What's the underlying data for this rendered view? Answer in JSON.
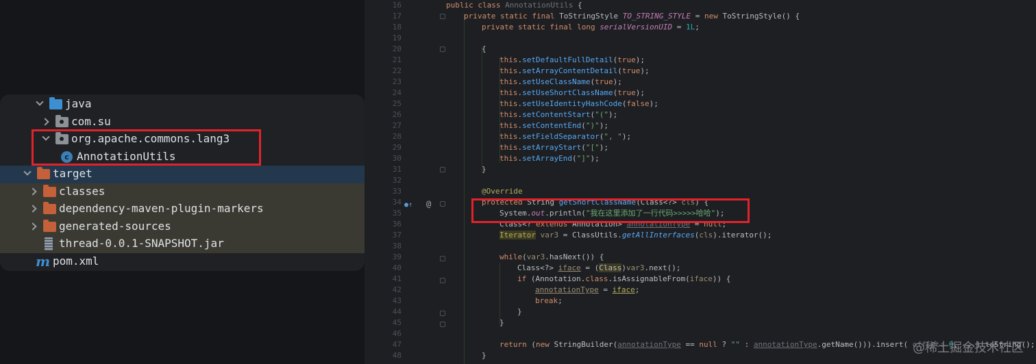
{
  "tree": {
    "items": [
      {
        "label": "java"
      },
      {
        "label": "com.su"
      },
      {
        "label": "org.apache.commons.lang3"
      },
      {
        "label": "AnnotationUtils"
      },
      {
        "label": "target"
      },
      {
        "label": "classes"
      },
      {
        "label": "dependency-maven-plugin-markers"
      },
      {
        "label": "generated-sources"
      },
      {
        "label": "thread-0.0.1-SNAPSHOT.jar"
      },
      {
        "label": "pom.xml"
      }
    ],
    "class_icon_letter": "c",
    "maven_icon_letter": "m"
  },
  "editor": {
    "line_numbers": [
      "16",
      "17",
      "18",
      "19",
      "20",
      "21",
      "22",
      "23",
      "24",
      "25",
      "26",
      "27",
      "28",
      "29",
      "30",
      "31",
      "32",
      "33",
      "34",
      "35",
      "36",
      "37",
      "38",
      "39",
      "40",
      "41",
      "42",
      "43",
      "44",
      "45",
      "46",
      "47",
      "48"
    ],
    "gutter_override_icon": "override-marker-icon",
    "gutter_annotation_symbol": "@"
  },
  "watermark": "@稀土掘金技术社区"
}
